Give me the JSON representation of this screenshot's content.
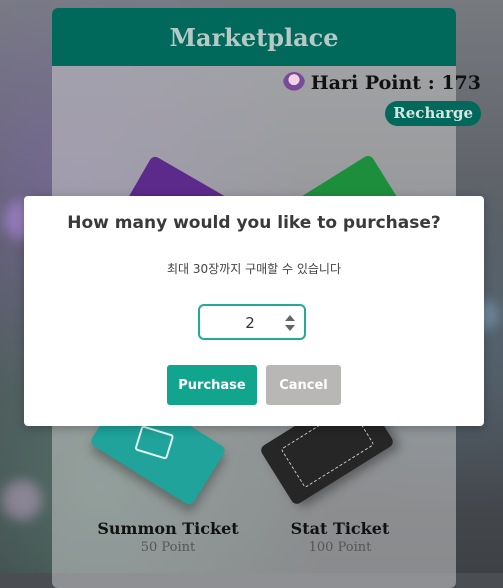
{
  "marketplace": {
    "title": "Marketplace",
    "points_text": "Hari Point : 173",
    "recharge_label": "Recharge",
    "brand_color": "#00695c"
  },
  "tickets": [
    {
      "name": "Summon Ticket",
      "price": "50 Point",
      "color": "#1fa39a"
    },
    {
      "name": "Stat Ticket",
      "price": "100 Point",
      "color": "#262626"
    }
  ],
  "modal": {
    "title": "How many would you like to purchase?",
    "subtitle": "최대 30장까지 구매할 수 있습니다",
    "quantity": "2",
    "purchase_label": "Purchase",
    "cancel_label": "Cancel",
    "accent_color": "#12a58e"
  }
}
